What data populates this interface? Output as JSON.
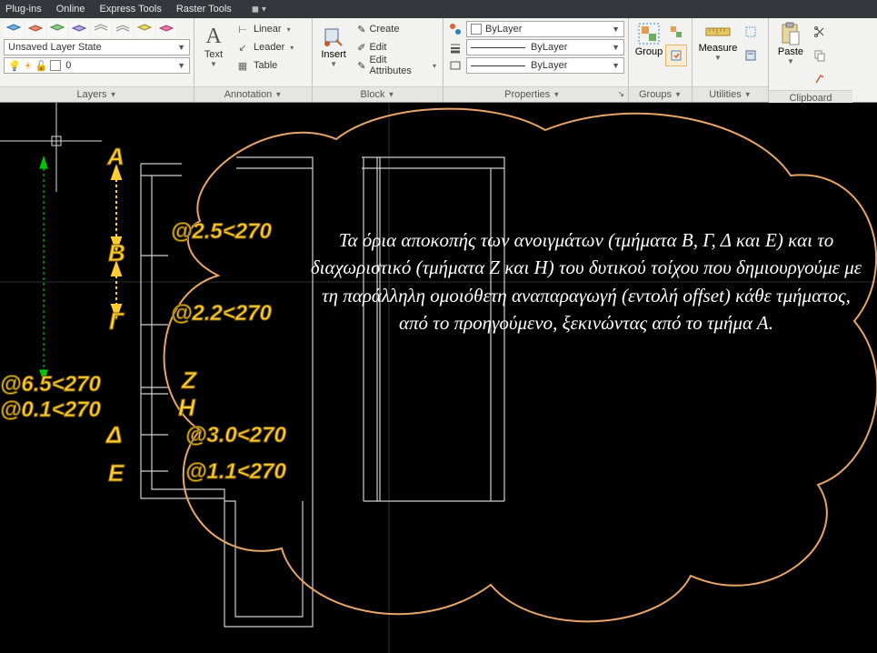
{
  "menubar": {
    "items": [
      "Plug-ins",
      "Online",
      "Express Tools",
      "Raster Tools"
    ]
  },
  "panels": {
    "layers": {
      "label": "Layers",
      "state_dd": "Unsaved Layer State",
      "current_layer": "0"
    },
    "annotation": {
      "label": "Annotation",
      "text_btn": "Text",
      "linear": "Linear",
      "leader": "Leader",
      "table": "Table"
    },
    "block": {
      "label": "Block",
      "insert_btn": "Insert",
      "create": "Create",
      "edit": "Edit",
      "edit_attr": "Edit Attributes"
    },
    "properties": {
      "label": "Properties",
      "color_dd": "ByLayer",
      "lw_dd": "ByLayer",
      "lt_dd": "ByLayer"
    },
    "groups": {
      "label": "Groups",
      "group_btn": "Group"
    },
    "utilities": {
      "label": "Utilities",
      "measure_btn": "Measure"
    },
    "clipboard": {
      "label": "Clipboard",
      "paste_btn": "Paste"
    }
  },
  "drawing": {
    "labels": {
      "A": "Α",
      "B": "Β",
      "G": "Γ",
      "Z": "Ζ",
      "H": "Η",
      "D": "Δ",
      "E": "Ε"
    },
    "coords": {
      "c1": "@2.5<270",
      "c2": "@2.2<270",
      "c3": "@3.0<270",
      "c4": "@1.1<270",
      "c5": "@6.5<270",
      "c6": "@0.1<270"
    },
    "note_text": "Τα όρια αποκοπής των ανοιγμάτων (τμήματα Β, Γ, Δ και Ε) και το διαχωριστικό (τμήματα Ζ και Η) του δυτικού τοίχου που δημιουργούμε με τη παράλληλη ομοιόθετη αναπαραγωγή (εντολή offset) κάθε τμήματος, από το προηγούμενο, ξεκινώντας από το τμήμα Α."
  }
}
